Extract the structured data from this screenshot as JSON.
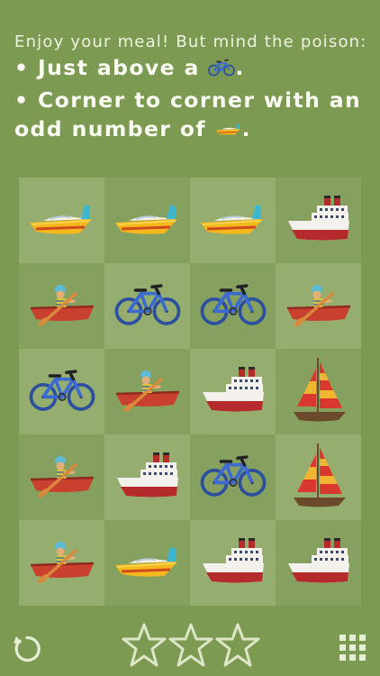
{
  "instructions": {
    "intro": "Enjoy your meal! But mind the poison:",
    "rule1_prefix": "• Just above a",
    "rule1_suffix": ".",
    "rule2_prefix": "• Corner to corner with an odd number of",
    "rule2_suffix": "."
  },
  "board": {
    "rows": 5,
    "cols": 4,
    "cells": [
      [
        "speedboat-icon",
        "speedboat-icon",
        "speedboat-icon",
        "ship-icon"
      ],
      [
        "rowboat-icon",
        "bicycle-icon",
        "bicycle-icon",
        "rowboat-icon"
      ],
      [
        "bicycle-icon",
        "rowboat-icon",
        "ship-icon",
        "sailboat-icon"
      ],
      [
        "rowboat-icon",
        "ship-icon",
        "bicycle-icon",
        "sailboat-icon"
      ],
      [
        "rowboat-icon",
        "speedboat-icon",
        "ship-icon",
        "ship-icon"
      ]
    ]
  },
  "footer": {
    "restart_icon": "restart-icon",
    "stars_earned": 0,
    "stars_total": 3,
    "menu_icon": "grid-menu-icon"
  },
  "colors": {
    "background": "#7d9a52",
    "cell_light": "#95ad6f",
    "cell_dark": "#86a060",
    "text": "#f4f7ea",
    "star_outline": "#dde7c8"
  }
}
